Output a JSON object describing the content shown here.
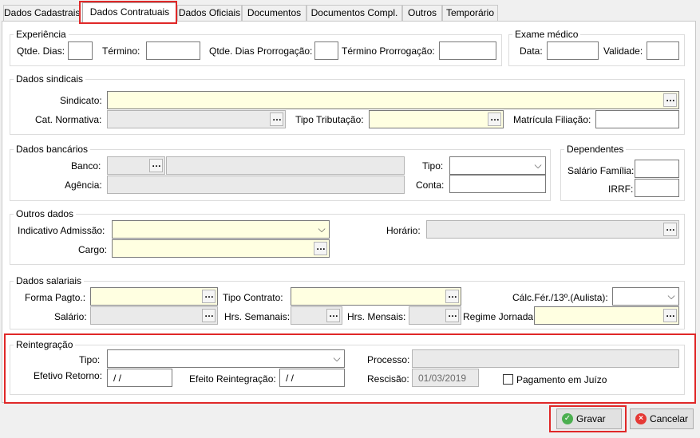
{
  "tabs": [
    "Dados Cadastrais",
    "Dados Contratuais",
    "Dados Oficiais",
    "Documentos",
    "Documentos Compl.",
    "Outros",
    "Temporário"
  ],
  "experiencia": {
    "title": "Experiência",
    "qtde_dias": "Qtde. Dias:",
    "termino": "Término:",
    "qtde_prorrog": "Qtde. Dias Prorrogação:",
    "termino_prorrog": "Término Prorrogação:"
  },
  "exame": {
    "title": "Exame médico",
    "data": "Data:",
    "validade": "Validade:"
  },
  "sindicais": {
    "title": "Dados sindicais",
    "sindicato": "Sindicato:",
    "cat_normativa": "Cat. Normativa:",
    "tipo_tributacao": "Tipo Tributação:",
    "matricula_filiacao": "Matrícula Filiação:"
  },
  "bancarios": {
    "title": "Dados bancários",
    "banco": "Banco:",
    "agencia": "Agência:",
    "tipo": "Tipo:",
    "conta": "Conta:"
  },
  "dependentes": {
    "title": "Dependentes",
    "salario_familia": "Salário Família:",
    "irrf": "IRRF:"
  },
  "outros": {
    "title": "Outros dados",
    "indicativo_admissao": "Indicativo Admissão:",
    "cargo": "Cargo:",
    "horario": "Horário:"
  },
  "salariais": {
    "title": "Dados salariais",
    "forma_pagto": "Forma Pagto.:",
    "tipo_contrato": "Tipo Contrato:",
    "calc_fer": "Cálc.Fér./13º.(Aulista):",
    "salario": "Salário:",
    "hrs_semanais": "Hrs. Semanais:",
    "hrs_mensais": "Hrs. Mensais:",
    "regime_jornada": "Regime Jornada:"
  },
  "reintegracao": {
    "title": "Reintegração",
    "tipo": "Tipo:",
    "processo": "Processo:",
    "efetivo_retorno": "Efetivo Retorno:",
    "efetivo_retorno_value": "/ /",
    "efeito_reintegracao": "Efeito Reintegração:",
    "efeito_reintegracao_value": "/ /",
    "rescisao": "Rescisão:",
    "rescisao_value": "01/03/2019",
    "pagamento_juizo": "Pagamento em Juízo"
  },
  "buttons": {
    "gravar": "Gravar",
    "cancelar": "Cancelar"
  },
  "colors": {
    "required": "#ffffe1",
    "highlight": "#e02828",
    "disabled": "#eaeaea"
  },
  "icons": {
    "ellipsis": "…",
    "dropdown": "⌵",
    "gravar": "check-icon",
    "cancelar": "cancel-icon"
  }
}
